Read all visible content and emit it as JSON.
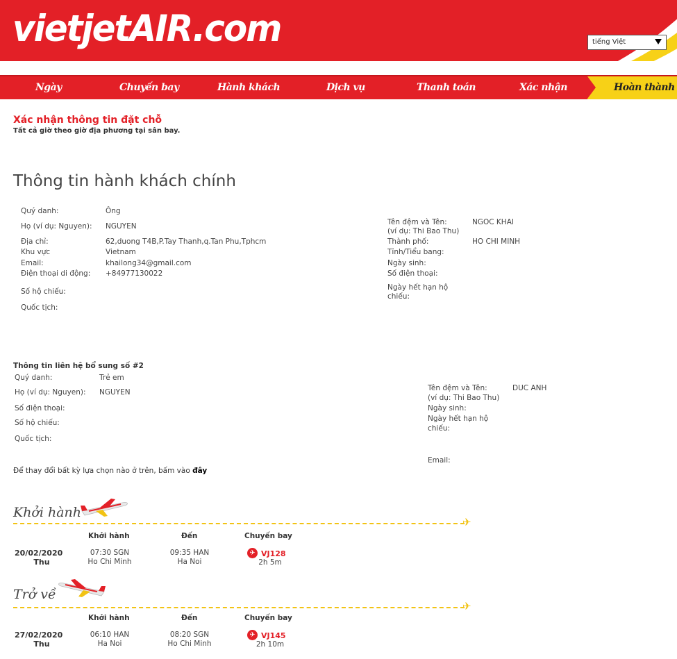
{
  "header": {
    "logo": "vietjetAIR.com",
    "language": "tiếng Việt"
  },
  "steps": [
    "Ngày",
    "Chuyến bay",
    "Hành khách",
    "Dịch vụ",
    "Thanh toán",
    "Xác nhận",
    "Hoàn thành"
  ],
  "confirm": {
    "title": "Xác nhận thông tin đặt chỗ",
    "subtitle": "Tất cả giờ theo giờ địa phương tại sân bay."
  },
  "main_passenger": {
    "section_title": "Thông tin hành khách chính",
    "title_label": "Quý danh:",
    "title_value": "Ông",
    "lastname_label": "Họ (ví dụ: Nguyen):",
    "lastname_value": "NGUYEN",
    "address_label": "Địa chỉ:",
    "address_value": "62,duong T4B,P.Tay Thanh,q.Tan Phu,Tphcm",
    "region_label": "Khu vực",
    "region_value": "Vietnam",
    "email_label": "Email:",
    "email_value": "khailong34@gmail.com",
    "mobile_label": "Điện thoại di động:",
    "mobile_value": "+84977130022",
    "passport_label": "Số hộ chiếu:",
    "nationality_label": "Quốc tịch:",
    "firstname_label_1": "Tên đệm và Tên:",
    "firstname_label_2": "(ví dụ: Thi Bao Thu)",
    "firstname_value": "NGOC KHAI",
    "city_label": "Thành phố:",
    "city_value": "HO CHI MINH",
    "state_label": "Tỉnh/Tiểu bang:",
    "dob_label": "Ngày sinh:",
    "phone_label": "Số điện thoại:",
    "passport_exp_label_1": "Ngày hết hạn hộ",
    "passport_exp_label_2": "chiếu:"
  },
  "contact2": {
    "heading": "Thông tin liên hệ bổ sung số #2",
    "title_label": "Quý danh:",
    "title_value": "Trẻ em",
    "lastname_label": "Họ (ví dụ: Nguyen):",
    "lastname_value": "NGUYEN",
    "phone_label": "Số điện thoại:",
    "passport_label": "Số hộ chiếu:",
    "nationality_label": "Quốc tịch:",
    "firstname_label_1": "Tên đệm và Tên:",
    "firstname_label_2": "(ví dụ: Thi Bao Thu)",
    "firstname_value": "DUC ANH",
    "dob_label": "Ngày sinh:",
    "passport_exp_label_1": "Ngày hết hạn hộ",
    "passport_exp_label_2": "chiếu:",
    "email_label": "Email:"
  },
  "change_note": {
    "text": "Để thay đổi bất kỳ lựa chọn nào ở trên, bấm vào ",
    "link": "đây"
  },
  "flights": {
    "col_depart": "Khởi hành",
    "col_arrive": "Đến",
    "col_flight": "Chuyến bay",
    "departure": {
      "heading": "Khởi hành",
      "date": "20/02/2020",
      "day": "Thu",
      "dep_time": "07:30 SGN",
      "dep_city": "Ho Chi Minh",
      "arr_time": "09:35 HAN",
      "arr_city": "Ha Noi",
      "flight_no": "VJ128",
      "duration": "2h 5m"
    },
    "return": {
      "heading": "Trở về",
      "date": "27/02/2020",
      "day": "Thu",
      "dep_time": "06:10 HAN",
      "dep_city": "Ha Noi",
      "arr_time": "08:20 SGN",
      "arr_city": "Ho Chi Minh",
      "flight_no": "VJ145",
      "duration": "2h 10m"
    }
  },
  "colors": {
    "brand_red": "#e32027",
    "brand_yellow": "#f7d117"
  }
}
